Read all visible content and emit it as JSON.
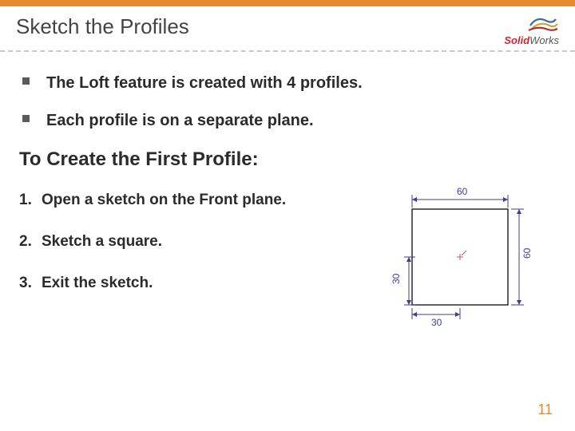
{
  "title": "Sketch the Profiles",
  "logo": {
    "solid": "Solid",
    "works": "Works"
  },
  "bullets": [
    "The Loft feature is created with 4 profiles.",
    "Each profile is on a separate plane."
  ],
  "subhead": "To Create the First Profile:",
  "steps": [
    "Open a sketch on the Front plane.",
    "Sketch a square.",
    "Exit the sketch."
  ],
  "diagram": {
    "width_label": "60",
    "height_label": "60",
    "half_width_label": "30",
    "half_height_label": "30"
  },
  "page_number": "11"
}
